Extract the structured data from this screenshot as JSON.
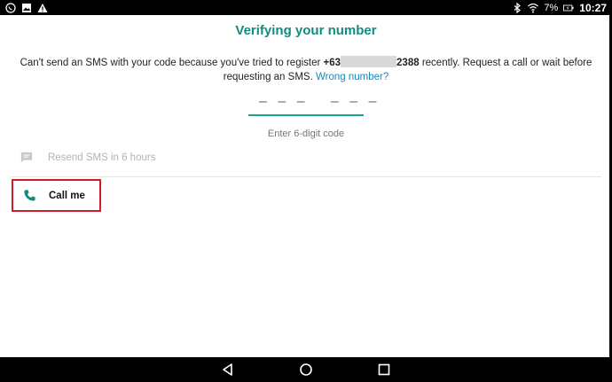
{
  "status_bar": {
    "battery": "7%",
    "time": "10:27",
    "icons": [
      "whatsapp-icon",
      "image-icon",
      "warning-icon",
      "bluetooth-icon",
      "wifi-icon",
      "battery-charging-icon"
    ]
  },
  "screen": {
    "title": "Verifying your number",
    "message_part1": "Can't send an SMS with your code because you've tried to register ",
    "number_prefix": "+63",
    "number_suffix": "2388",
    "message_part2": " recently. Request a call or wait before requesting an SMS. ",
    "wrong_number_link": "Wrong number?",
    "code_placeholder": "– – –   – – –",
    "code_hint": "Enter 6-digit code",
    "resend_label": "Resend SMS in 6 hours",
    "call_label": "Call me"
  },
  "colors": {
    "accent": "#128C7E",
    "link": "#1e88b5",
    "highlight_box": "#d11a2a"
  },
  "nav_bar": {
    "icons": [
      "back-icon",
      "home-icon",
      "recents-icon"
    ]
  }
}
